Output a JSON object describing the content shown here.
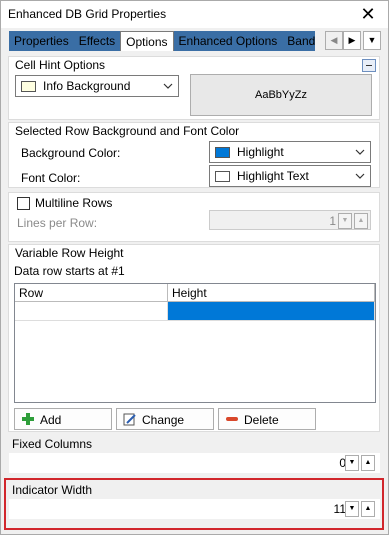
{
  "window": {
    "title": "Enhanced DB Grid Properties",
    "close_glyph": "✕"
  },
  "tabs": {
    "items": [
      {
        "label": "Properties",
        "active": false
      },
      {
        "label": "Effects",
        "active": false
      },
      {
        "label": "Options",
        "active": true
      },
      {
        "label": "Enhanced Options",
        "active": false
      },
      {
        "label": "Bands",
        "active": false
      }
    ],
    "scroll_left_glyph": "◀",
    "scroll_right_glyph": "▶",
    "menu_glyph": "▼"
  },
  "cell_hint": {
    "title": "Cell Hint Options",
    "color_value": "Info Background",
    "color_swatch": "#ffffe1",
    "preview_text": "AaBbYyZz"
  },
  "selected_row": {
    "title": "Selected Row Background and Font Color",
    "bg_label": "Background Color:",
    "bg_value": "Highlight",
    "bg_swatch": "#0078d7",
    "font_label": "Font Color:",
    "font_value": "Highlight Text",
    "font_swatch": "#ffffff"
  },
  "multiline": {
    "checkbox_label": "Multiline Rows",
    "checked": false,
    "lines_label": "Lines per Row:",
    "lines_value": "1"
  },
  "variable_row": {
    "title": "Variable Row Height",
    "subtitle": "Data row starts at #1",
    "columns": [
      "Row",
      "Height"
    ],
    "selection_color": "#0078d7",
    "buttons": {
      "add": "Add",
      "change": "Change",
      "delete": "Delete"
    }
  },
  "fixed_columns": {
    "label": "Fixed Columns",
    "value": "0"
  },
  "indicator_width": {
    "label": "Indicator Width",
    "value": "11",
    "highlight_color": "#d1262c"
  },
  "spin_glyphs": {
    "down": "▼",
    "up": "▲"
  }
}
